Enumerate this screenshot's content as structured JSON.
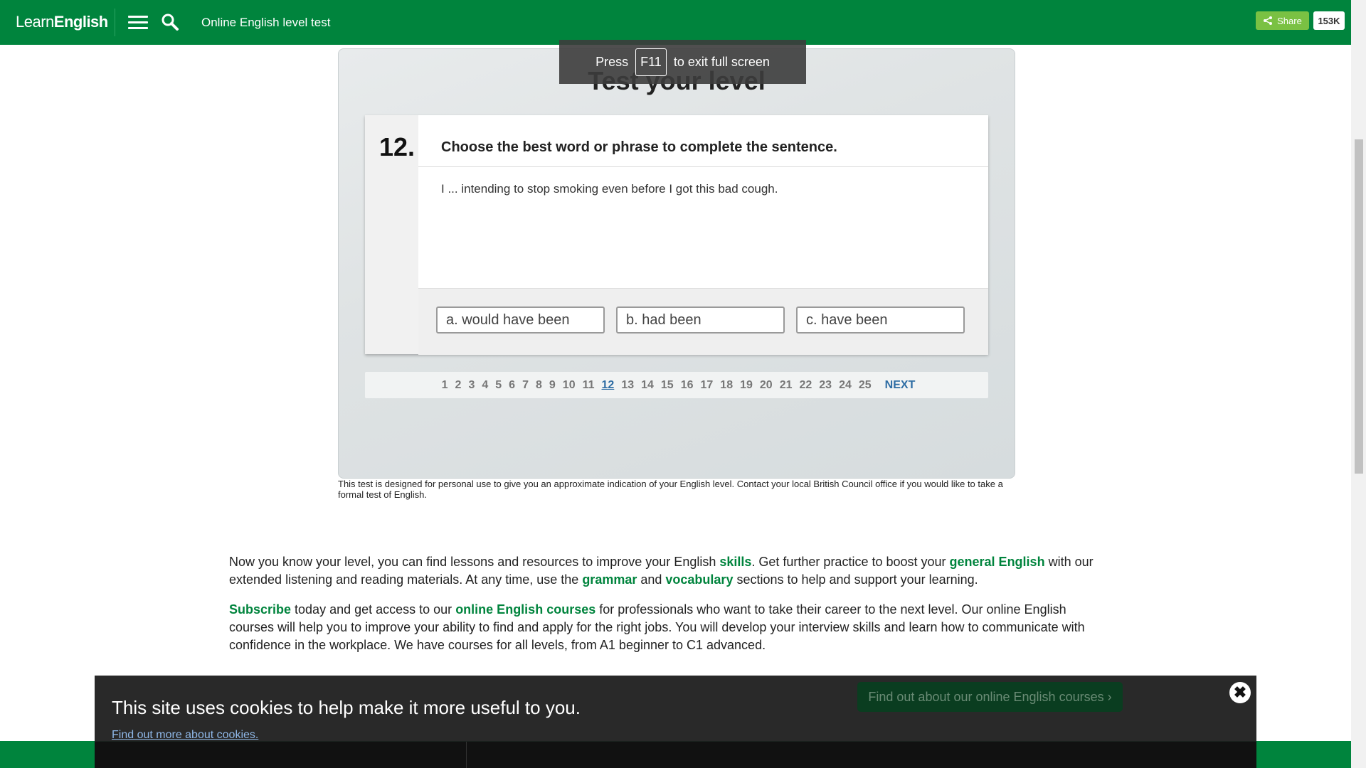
{
  "header": {
    "logo_part1": "Learn",
    "logo_part2": "English",
    "title": "Online English level test",
    "share_label": "Share",
    "share_count": "153K"
  },
  "fullscreen": {
    "press": "Press",
    "key": "F11",
    "message": "to exit full screen"
  },
  "test": {
    "heading": "Test your level",
    "question_number": "12.",
    "instruction": "Choose the best word or phrase to complete the sentence.",
    "sentence": "I ... intending to stop smoking even before I got this bad cough.",
    "answers": [
      "a. would have been",
      "b. had been",
      "c. have been"
    ],
    "pages": [
      "1",
      "2",
      "3",
      "4",
      "5",
      "6",
      "7",
      "8",
      "9",
      "10",
      "11",
      "12",
      "13",
      "14",
      "15",
      "16",
      "17",
      "18",
      "19",
      "20",
      "21",
      "22",
      "23",
      "24",
      "25"
    ],
    "current_page": "12",
    "next_label": "NEXT",
    "disclaimer": "This test is designed for personal use to give you an approximate indication of your English level. Contact your local British Council office if you would like to take a formal test of English."
  },
  "content": {
    "p1": {
      "t1": "Now you know your level, you can find lessons and resources to improve your English ",
      "l1": "skills",
      "t2": ". Get further practice to boost your ",
      "l2": "general English",
      "t3": " with our extended listening and reading materials. At any time, use the ",
      "l3": "grammar",
      "t4": " and ",
      "l4": "vocabulary",
      "t5": " sections to help and support your learning."
    },
    "p2": {
      "l1": "Subscribe",
      "t1": " today and get access to our ",
      "l2": "online English courses",
      "t2": " for professionals who want to take their career to the next level. Our online English courses will help you to improve your ability to find and apply for the right jobs. You will develop your interview skills and learn how to communicate with confidence in the workplace. We have courses for all levels, from A1 beginner to C1 advanced."
    }
  },
  "cookie": {
    "title": "This site uses cookies to help make it more useful to you.",
    "link": "Find out more about cookies.",
    "cta": "Find out about our online English courses ›",
    "close": "✖"
  },
  "colors": {
    "brand_green": "#00843d",
    "share_green": "#7ac143",
    "link_blue": "#2e6da4"
  }
}
